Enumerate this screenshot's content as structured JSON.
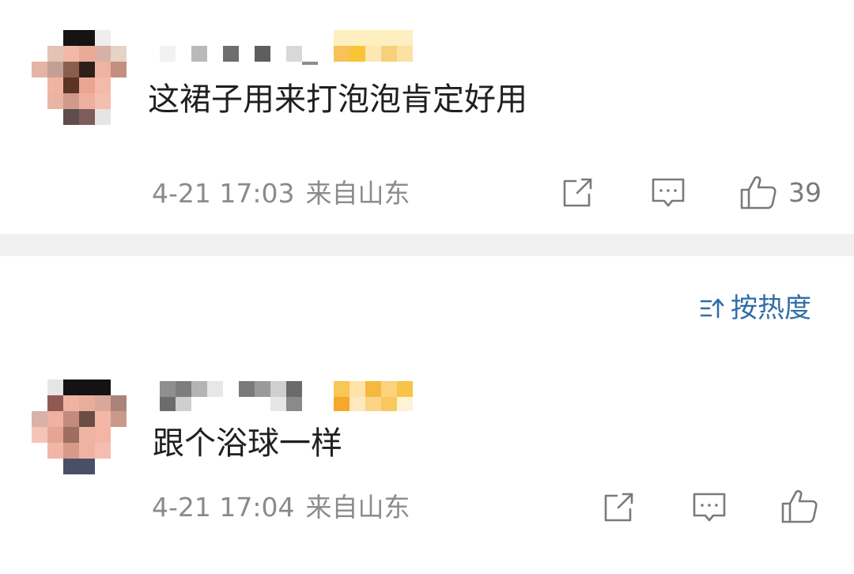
{
  "comments": [
    {
      "text": "这裙子用来打泡泡肯定好用",
      "time": "4-21 17:03",
      "location": "来自山东",
      "like_count": "39"
    },
    {
      "text": "跟个浴球一样",
      "time": "4-21 17:04",
      "location": "来自山东",
      "like_count": ""
    }
  ],
  "sort": {
    "label": "按热度"
  },
  "icons": {
    "share": "share-icon",
    "comment": "comment-icon",
    "like": "thumbs-up-icon",
    "sort": "sort-icon"
  },
  "colors": {
    "meta_text": "#8b8b8b",
    "sort_accent": "#2f6ea8",
    "divider": "#f0f0f0"
  }
}
